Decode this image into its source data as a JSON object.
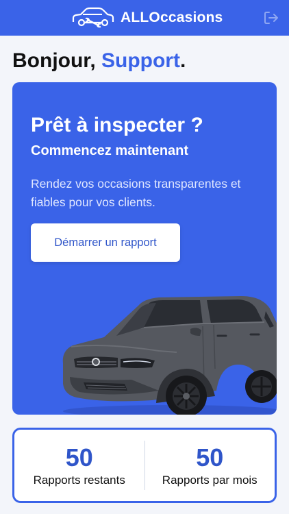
{
  "header": {
    "brand": "ALLOccasions"
  },
  "greeting": {
    "prefix": "Bonjour,",
    "name": "Support",
    "suffix": "."
  },
  "hero": {
    "title": "Prêt à inspecter ?",
    "subtitle": "Commencez maintenant",
    "description": "Rendez vos occasions transparentes et fiables pour vos clients.",
    "cta_label": "Démarrer un rapport"
  },
  "stats": [
    {
      "value": "50",
      "label": "Rapports restants"
    },
    {
      "value": "50",
      "label": "Rapports par mois"
    }
  ],
  "colors": {
    "primary": "#3a63e8",
    "background": "#f3f5fa"
  },
  "icons": {
    "brand": "car-wrench-logo-icon",
    "logout": "logout-icon"
  }
}
